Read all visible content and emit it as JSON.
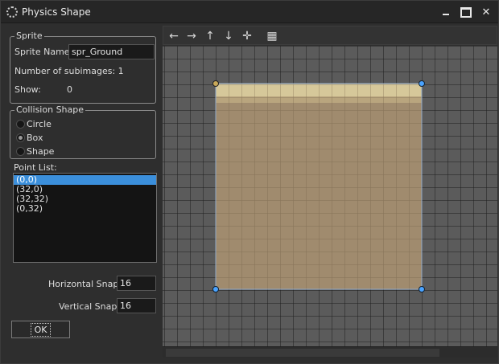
{
  "window": {
    "title": "Physics Shape",
    "close_glyph": "✕"
  },
  "sprite_group": {
    "title": "Sprite",
    "name_label": "Sprite Name:",
    "name_value": "spr_Ground",
    "subimages_text": "Number of subimages: 1",
    "show_label": "Show:",
    "show_value": "0"
  },
  "collision_group": {
    "title": "Collision Shape",
    "options": [
      {
        "label": "Circle",
        "checked": false
      },
      {
        "label": "Box",
        "checked": true
      },
      {
        "label": "Shape",
        "checked": false
      }
    ]
  },
  "point_list": {
    "label": "Point List:",
    "items": [
      "(0,0)",
      "(32,0)",
      "(32,32)",
      "(0,32)"
    ],
    "selected_index": 0
  },
  "snap": {
    "horizontal_label": "Horizontal Snap:",
    "horizontal_value": "16",
    "vertical_label": "Vertical Snap:",
    "vertical_value": "16"
  },
  "ok_button": {
    "label": "OK"
  },
  "toolbar": {
    "tools": [
      {
        "icon": "arrow-left-icon",
        "glyph": "←"
      },
      {
        "icon": "arrow-right-icon",
        "glyph": "→"
      },
      {
        "icon": "arrow-up-icon",
        "glyph": "↑"
      },
      {
        "icon": "arrow-down-icon",
        "glyph": "↓"
      },
      {
        "icon": "center-cross-icon",
        "glyph": "✛"
      },
      {
        "icon": "grid-toggle-icon",
        "glyph": "▦"
      }
    ]
  },
  "colors": {
    "grid_line": "#1e1e1e",
    "grid_bg": "#5b5b5b",
    "sprite_fill": "#a08b6e",
    "sprite_top": "#d6c89a",
    "handle": "#4aa3ff",
    "selected_row": "#3b8fdb"
  }
}
